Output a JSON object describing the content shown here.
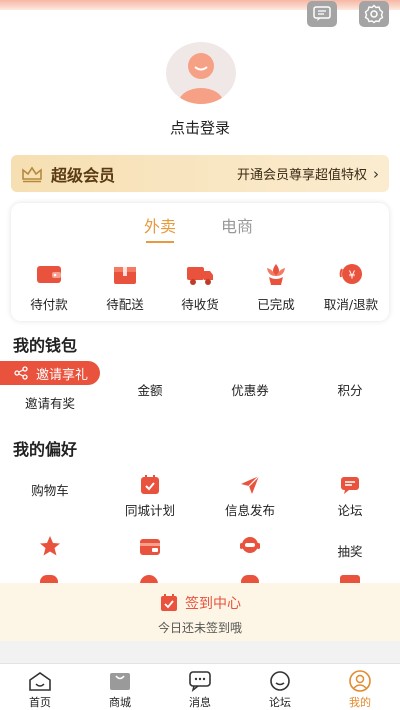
{
  "header": {
    "login_text": "点击登录"
  },
  "vip": {
    "title": "超级会员",
    "desc": "开通会员尊享超值特权",
    "arrow": "›"
  },
  "tabs": [
    {
      "label": "外卖"
    },
    {
      "label": "电商"
    }
  ],
  "orders": [
    {
      "label": "待付款",
      "icon": "wallet-icon"
    },
    {
      "label": "待配送",
      "icon": "package-icon"
    },
    {
      "label": "待收货",
      "icon": "truck-icon"
    },
    {
      "label": "已完成",
      "icon": "flower-icon"
    },
    {
      "label": "取消/退款",
      "icon": "refund-icon"
    }
  ],
  "wallet": {
    "title": "我的钱包",
    "invite_badge": "邀请享礼",
    "items": [
      {
        "label": "邀请有奖"
      },
      {
        "label": "金额"
      },
      {
        "label": "优惠券"
      },
      {
        "label": "积分"
      }
    ]
  },
  "prefs": {
    "title": "我的偏好",
    "items": [
      {
        "label": "购物车"
      },
      {
        "label": "同城计划",
        "icon": "calendar-check-icon"
      },
      {
        "label": "信息发布",
        "icon": "send-icon"
      },
      {
        "label": "论坛",
        "icon": "chat-icon"
      },
      {
        "label": "",
        "icon": "star-icon"
      },
      {
        "label": "",
        "icon": "wallet-card-icon"
      },
      {
        "label": "",
        "icon": "headset-icon"
      },
      {
        "label": "抽奖"
      }
    ]
  },
  "signin": {
    "title": "签到中心",
    "subtitle": "今日还未签到哦"
  },
  "bottom_nav": [
    {
      "label": "首页",
      "icon": "home-icon"
    },
    {
      "label": "商城",
      "icon": "shop-bag-icon"
    },
    {
      "label": "消息",
      "icon": "message-icon"
    },
    {
      "label": "论坛",
      "icon": "forum-icon"
    },
    {
      "label": "我的",
      "icon": "profile-icon",
      "active": true
    }
  ],
  "colors": {
    "accent": "#e79a3f",
    "brand_red": "#e9523c",
    "vip_bg": "#f6dfb2",
    "signin_bg": "#fdf6e6"
  }
}
